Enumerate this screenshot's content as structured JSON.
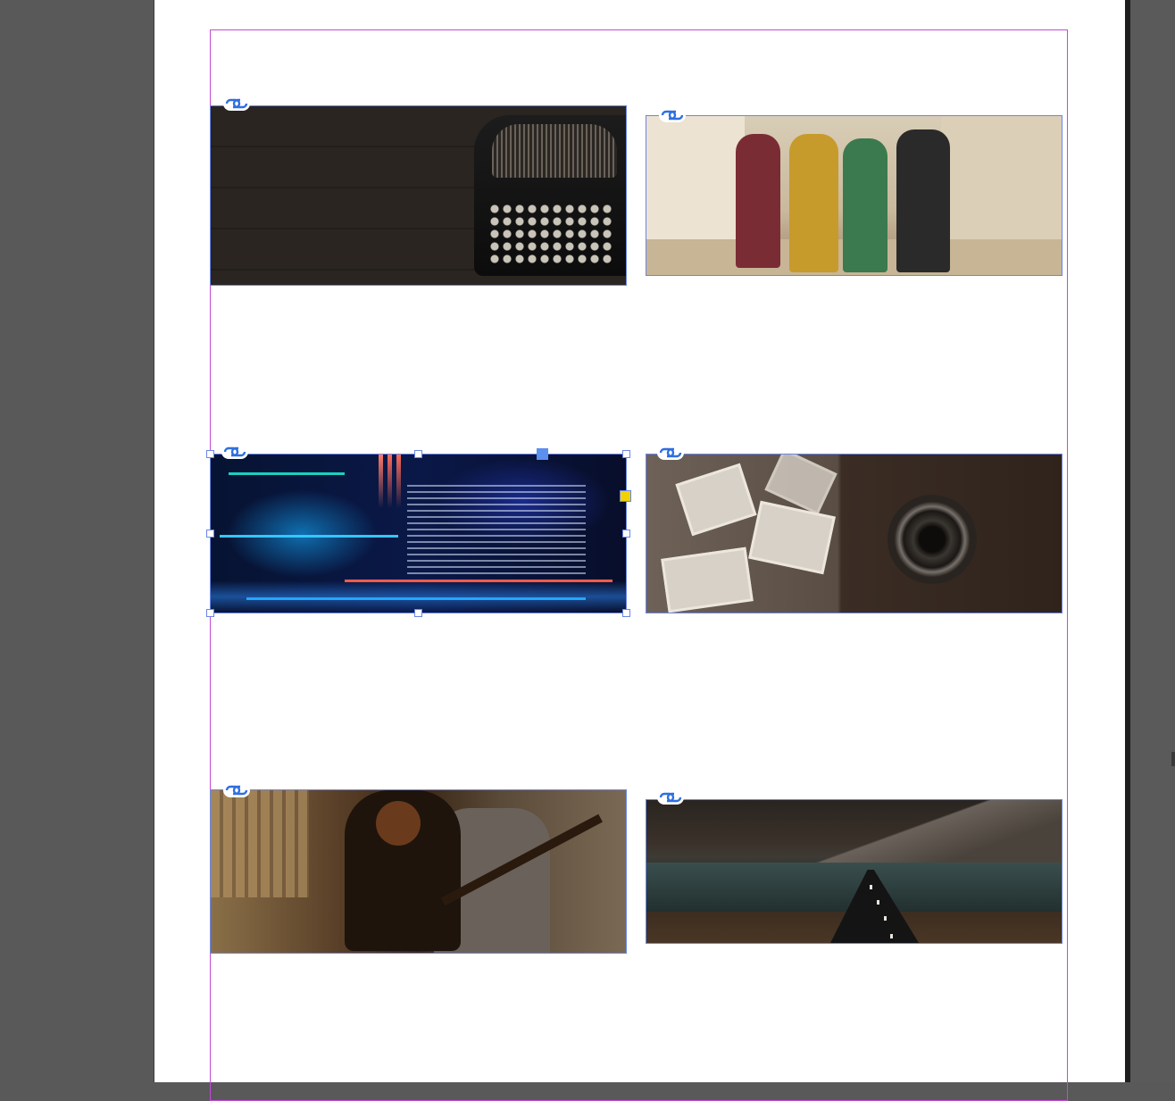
{
  "document": {
    "page_color": "#ffffff",
    "pasteboard_color": "#595959",
    "margin_guide_color": "#c24bd6",
    "frame_edge_color": "#6a86e6"
  },
  "frames": [
    {
      "name": "image-frame-typewriter",
      "content": "typewriter-photo",
      "linked": true,
      "selected": false
    },
    {
      "name": "image-frame-people",
      "content": "people-reading-photo",
      "linked": true,
      "selected": false
    },
    {
      "name": "image-frame-code",
      "content": "code-screen-photo",
      "linked": true,
      "selected": true
    },
    {
      "name": "image-frame-camera",
      "content": "vintage-camera-photo",
      "linked": true,
      "selected": false
    },
    {
      "name": "image-frame-guitar",
      "content": "woman-guitar-photo",
      "linked": true,
      "selected": false
    },
    {
      "name": "image-frame-road",
      "content": "mountain-road-photo",
      "linked": true,
      "selected": false
    }
  ],
  "icons": {
    "link": "link-icon"
  }
}
